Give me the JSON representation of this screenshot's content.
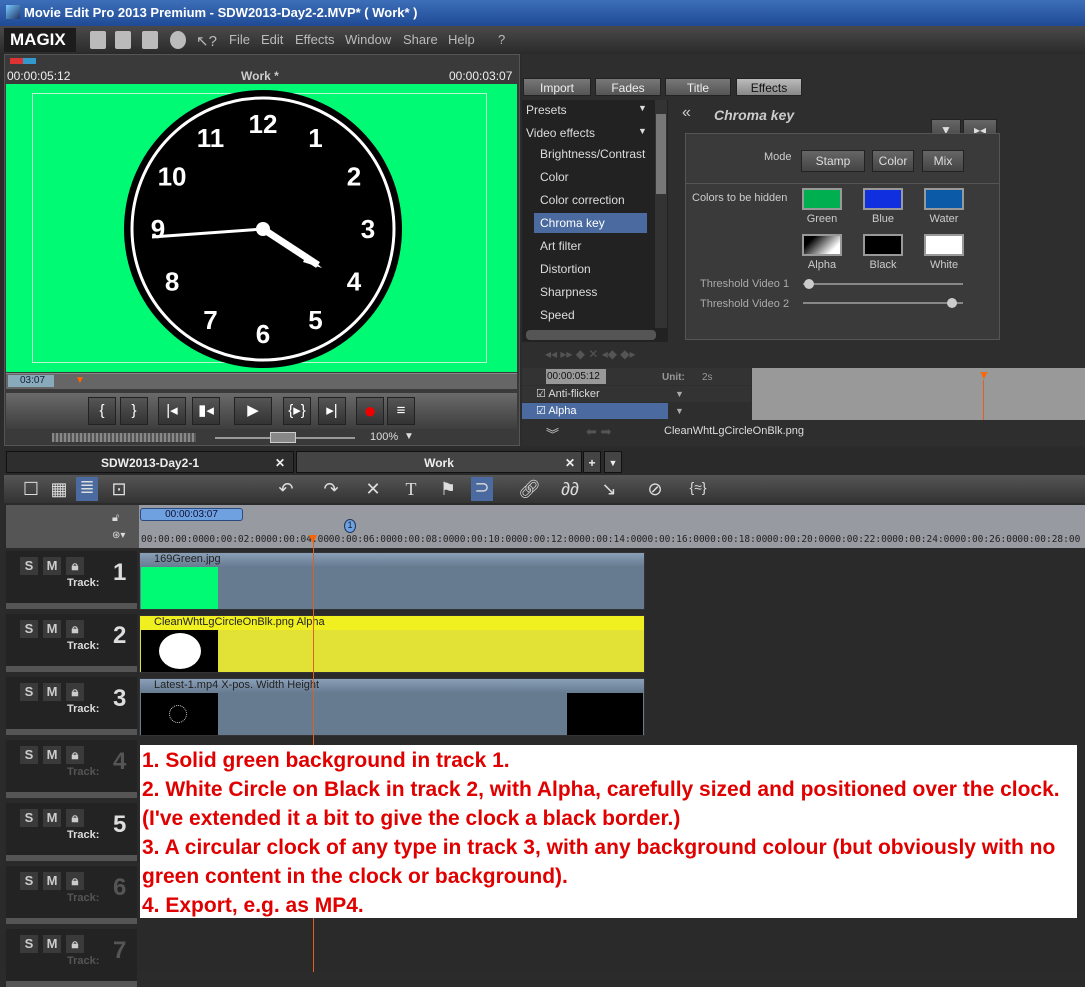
{
  "window": {
    "title": "Movie Edit Pro 2013 Premium - SDW2013-Day2-2.MVP* ( Work* )"
  },
  "menubar": {
    "logo": "MAGIX",
    "items": [
      "File",
      "Edit",
      "Effects",
      "Window",
      "Share",
      "Help"
    ]
  },
  "preview": {
    "time_left": "00:00:05:12",
    "title": "Work *",
    "time_right": "00:00:03:07",
    "strip_time": "03:07",
    "zoom": "100%",
    "clock_numbers": [
      "12",
      "1",
      "2",
      "3",
      "4",
      "5",
      "6",
      "7",
      "8",
      "9",
      "10",
      "11"
    ]
  },
  "media_tabs": [
    "Import",
    "Fades",
    "Title",
    "Effects"
  ],
  "effects_list": {
    "sections": [
      "Presets",
      "Video effects"
    ],
    "items": [
      "Brightness/Contrast",
      "Color",
      "Color correction",
      "Chroma key",
      "Art filter",
      "Distortion",
      "Sharpness",
      "Speed"
    ],
    "selected": "Chroma key"
  },
  "chroma": {
    "title": "Chroma key",
    "mode_label": "Mode",
    "modes": [
      "Stamp",
      "Color",
      "Mix"
    ],
    "colors_label": "Colors to be hidden",
    "swatches": [
      {
        "label": "Green",
        "color": "#00b050"
      },
      {
        "label": "Blue",
        "color": "#1030e0"
      },
      {
        "label": "Water",
        "color": "#0a5aa8"
      },
      {
        "label": "Alpha",
        "color": "#ffffff"
      },
      {
        "label": "Black",
        "color": "#000000"
      },
      {
        "label": "White",
        "color": "#ffffff"
      }
    ],
    "threshold1_label": "Threshold Video 1",
    "threshold1": 0.04,
    "threshold2_label": "Threshold Video 2",
    "threshold2": 0.93
  },
  "keyframes": {
    "time": "00:00:05:12",
    "unit_label": "Unit:",
    "unit": "2s",
    "rows": [
      "Anti-flicker",
      "Alpha"
    ],
    "file": "CleanWhtLgCircleOnBlk.png"
  },
  "arranger": {
    "tabs": [
      "SDW2013-Day2-1",
      "Work"
    ],
    "range_time": "00:00:03:07",
    "marker": "1",
    "ruler": [
      "00:00:00:00",
      "00:00:02:00",
      "00:00:04:00",
      "00:00:06:00",
      "00:00:08:00",
      "00:00:10:00",
      "00:00:12:00",
      "00:00:14:00",
      "00:00:16:00",
      "00:00:18:00",
      "00:00:20:00",
      "00:00:22:00",
      "00:00:24:00",
      "00:00:26:00",
      "00:00:28:00"
    ],
    "track_label": "Track:",
    "tracks": [
      "1",
      "2",
      "3",
      "4",
      "5",
      "6",
      "7"
    ],
    "clips": [
      {
        "name": "169Green.jpg"
      },
      {
        "name": "CleanWhtLgCircleOnBlk.png Alpha"
      },
      {
        "name": "Latest-1.mp4   X-pos.  Width  Height"
      }
    ]
  },
  "note": [
    "1. Solid green background in track 1.",
    "2. White Circle on Black in track 2, with Alpha, carefully sized and positioned over the clock. (I've extended it a bit to give the clock a black border.)",
    "3. A circular clock of any type in track 3, with any background colour (but obviously with no green content in the clock or background).",
    "4. Export, e.g. as MP4."
  ]
}
